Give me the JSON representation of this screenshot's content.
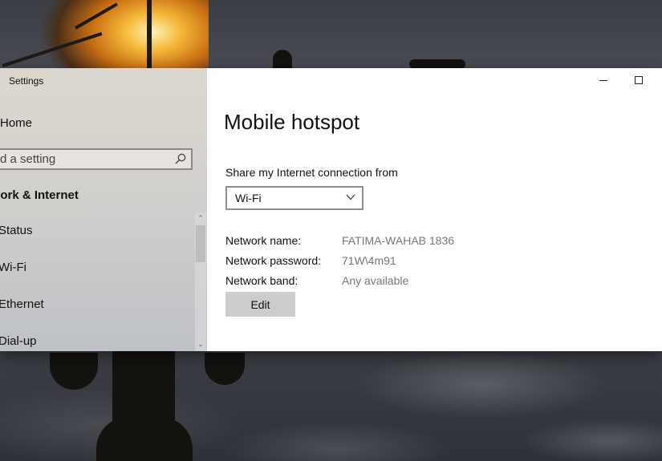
{
  "window": {
    "title": "Settings",
    "minimize_icon": "minimize-icon",
    "maximize_icon": "maximize-icon"
  },
  "sidebar": {
    "home_label": "Home",
    "search_placeholder": "d a setting",
    "search_icon": "search-icon",
    "section_label": "vork & Internet",
    "items": [
      {
        "label": "Status"
      },
      {
        "label": "Wi-Fi"
      },
      {
        "label": "Ethernet"
      },
      {
        "label": "Dial-up"
      }
    ]
  },
  "main": {
    "page_title": "Mobile hotspot",
    "share_label": "Share my Internet connection from",
    "share_selected": "Wi-Fi",
    "properties": [
      {
        "label": "Network name:",
        "value": "FATIMA-WAHAB 1836"
      },
      {
        "label": "Network password:",
        "value": "71W\\4m91"
      },
      {
        "label": "Network band:",
        "value": "Any available"
      }
    ],
    "edit_label": "Edit"
  }
}
